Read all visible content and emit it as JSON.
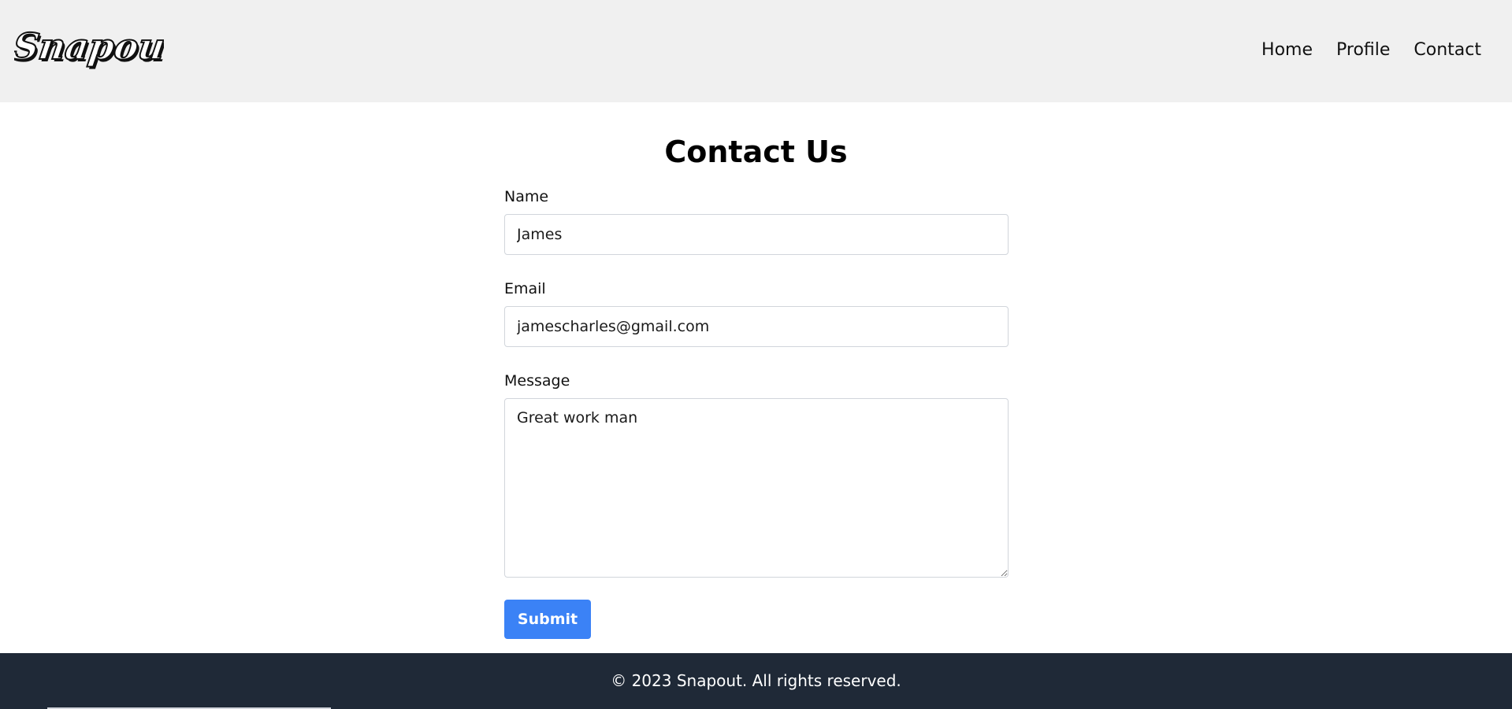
{
  "header": {
    "logo_text": "Snapout",
    "nav": [
      {
        "label": "Home"
      },
      {
        "label": "Profile"
      },
      {
        "label": "Contact"
      }
    ]
  },
  "main": {
    "title": "Contact Us",
    "form": {
      "name": {
        "label": "Name",
        "value": "James"
      },
      "email": {
        "label": "Email",
        "value": "jamescharles@gmail.com"
      },
      "message": {
        "label": "Message",
        "value": "Great work man"
      },
      "submit_label": "Submit"
    }
  },
  "footer": {
    "text": "© 2023 Snapout. All rights reserved."
  },
  "colors": {
    "header_bg": "#f0f0f0",
    "accent": "#3b82f6",
    "footer_bg": "#1f2937"
  }
}
